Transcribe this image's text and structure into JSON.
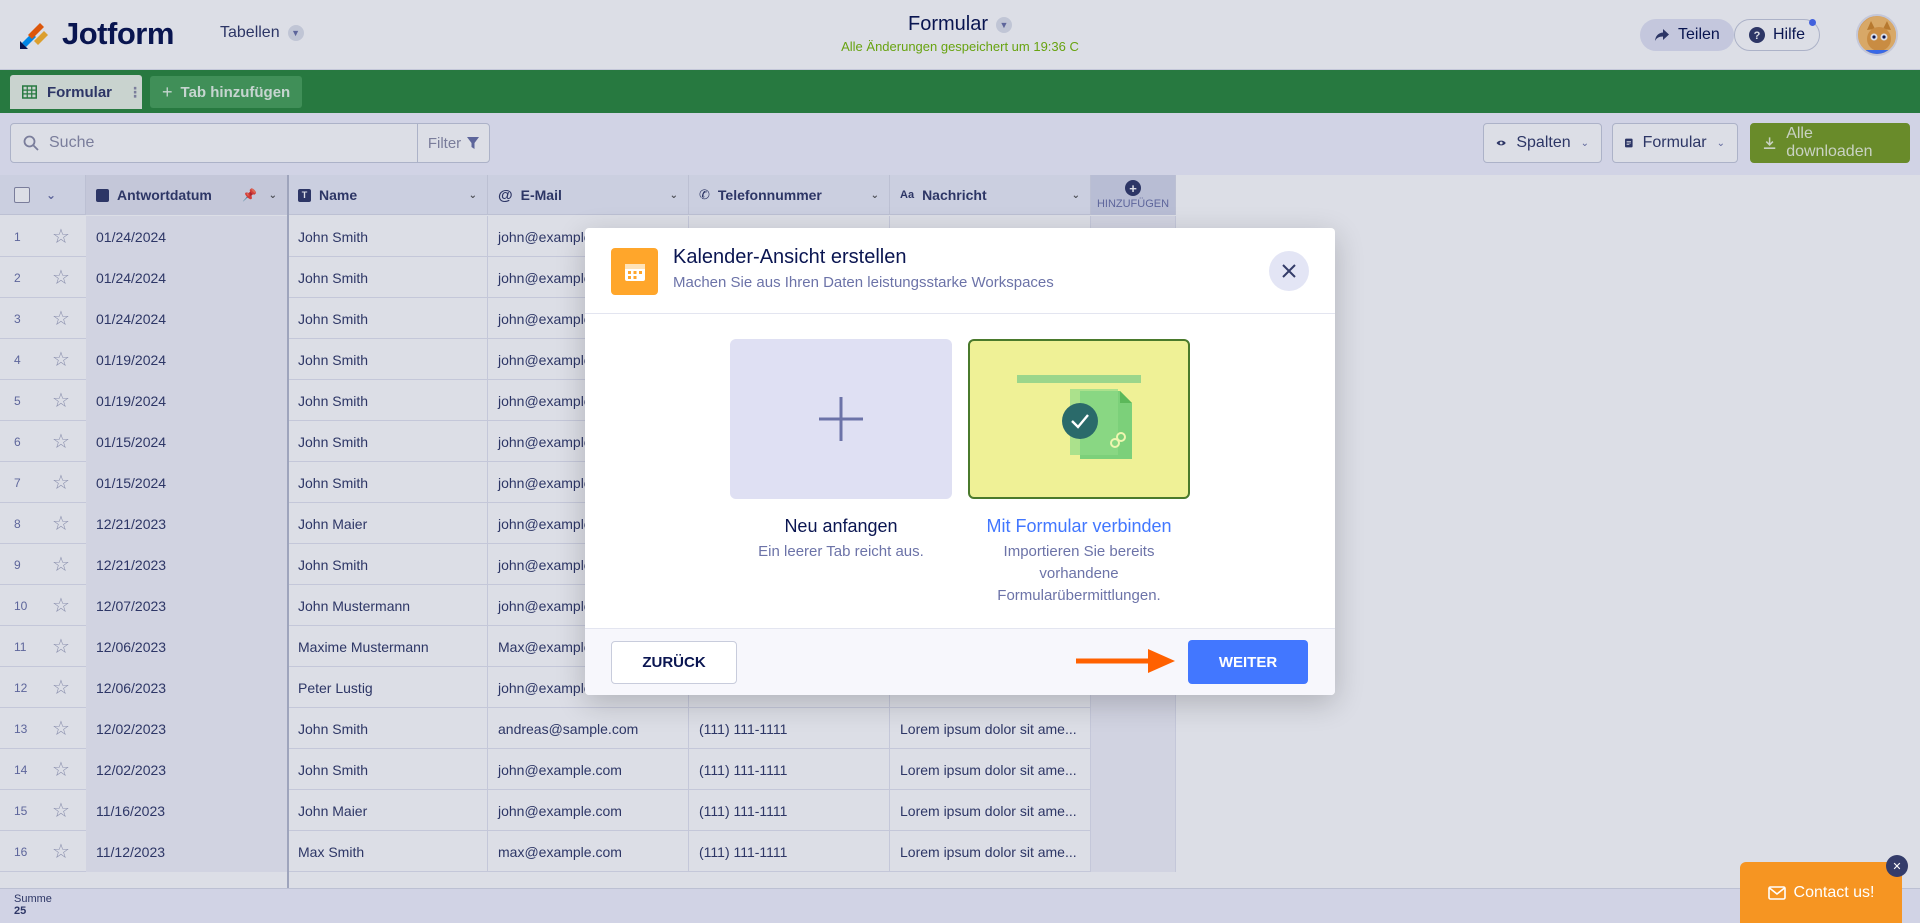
{
  "header": {
    "brand": "Jotform",
    "tables_label": "Tabellen",
    "form_title": "Formular",
    "save_status": "Alle Änderungen gespeichert um 19:36 C",
    "share_label": "Teilen",
    "help_label": "Hilfe"
  },
  "tabs": {
    "active_label": "Formular",
    "add_label": "Tab hinzufügen"
  },
  "toolbar": {
    "search_placeholder": "Suche",
    "filter_label": "Filter",
    "columns_label": "Spalten",
    "form_label": "Formular",
    "download_label": "Alle downloaden"
  },
  "table": {
    "columns": [
      "Antwortdatum",
      "Name",
      "E-Mail",
      "Telefonnummer",
      "Nachricht"
    ],
    "add_column_label": "HINZUFÜGEN",
    "rows": [
      {
        "n": "1",
        "date": "01/24/2024",
        "name": "John Smith",
        "email": "john@example",
        "phone": "",
        "msg": ""
      },
      {
        "n": "2",
        "date": "01/24/2024",
        "name": "John Smith",
        "email": "john@example",
        "phone": "",
        "msg": ""
      },
      {
        "n": "3",
        "date": "01/24/2024",
        "name": "John Smith",
        "email": "john@example",
        "phone": "",
        "msg": ""
      },
      {
        "n": "4",
        "date": "01/19/2024",
        "name": "John Smith",
        "email": "john@example",
        "phone": "",
        "msg": ""
      },
      {
        "n": "5",
        "date": "01/19/2024",
        "name": "John Smith",
        "email": "john@example",
        "phone": "",
        "msg": ""
      },
      {
        "n": "6",
        "date": "01/15/2024",
        "name": "John Smith",
        "email": "john@example",
        "phone": "",
        "msg": ""
      },
      {
        "n": "7",
        "date": "01/15/2024",
        "name": "John Smith",
        "email": "john@example",
        "phone": "",
        "msg": ""
      },
      {
        "n": "8",
        "date": "12/21/2023",
        "name": "John Maier",
        "email": "john@example",
        "phone": "",
        "msg": ""
      },
      {
        "n": "9",
        "date": "12/21/2023",
        "name": "John Smith",
        "email": "john@example",
        "phone": "",
        "msg": ""
      },
      {
        "n": "10",
        "date": "12/07/2023",
        "name": "John Mustermann",
        "email": "john@example",
        "phone": "",
        "msg": ""
      },
      {
        "n": "11",
        "date": "12/06/2023",
        "name": "Maxime Mustermann",
        "email": "Max@example",
        "phone": "",
        "msg": ""
      },
      {
        "n": "12",
        "date": "12/06/2023",
        "name": "Peter Lustig",
        "email": "john@example",
        "phone": "",
        "msg": ""
      },
      {
        "n": "13",
        "date": "12/02/2023",
        "name": "John Smith",
        "email": "andreas@sample.com",
        "phone": "(111) 111-1111",
        "msg": "Lorem ipsum dolor sit ame..."
      },
      {
        "n": "14",
        "date": "12/02/2023",
        "name": "John Smith",
        "email": "john@example.com",
        "phone": "(111) 111-1111",
        "msg": "Lorem ipsum dolor sit ame..."
      },
      {
        "n": "15",
        "date": "11/16/2023",
        "name": "John Maier",
        "email": "john@example.com",
        "phone": "(111) 111-1111",
        "msg": "Lorem ipsum dolor sit ame..."
      },
      {
        "n": "16",
        "date": "11/12/2023",
        "name": "Max Smith",
        "email": "max@example.com",
        "phone": "(111) 111-1111",
        "msg": "Lorem ipsum dolor sit ame..."
      }
    ],
    "sum_label": "Summe",
    "sum_value": "25"
  },
  "modal": {
    "title": "Kalender-Ansicht erstellen",
    "subtitle": "Machen Sie aus Ihren Daten leistungsstarke Workspaces",
    "option1_title": "Neu anfangen",
    "option1_desc": "Ein leerer Tab reicht aus.",
    "option2_title": "Mit Formular verbinden",
    "option2_desc": "Importieren Sie bereits vorhandene Formularübermittlungen.",
    "back_label": "ZURÜCK",
    "next_label": "WEITER"
  },
  "contact": {
    "label": "Contact us!"
  },
  "colors": {
    "brand_green": "#2d8a3e",
    "accent_blue": "#4277ff",
    "arrow_orange": "#ff6100",
    "contact_orange": "#f69522"
  }
}
